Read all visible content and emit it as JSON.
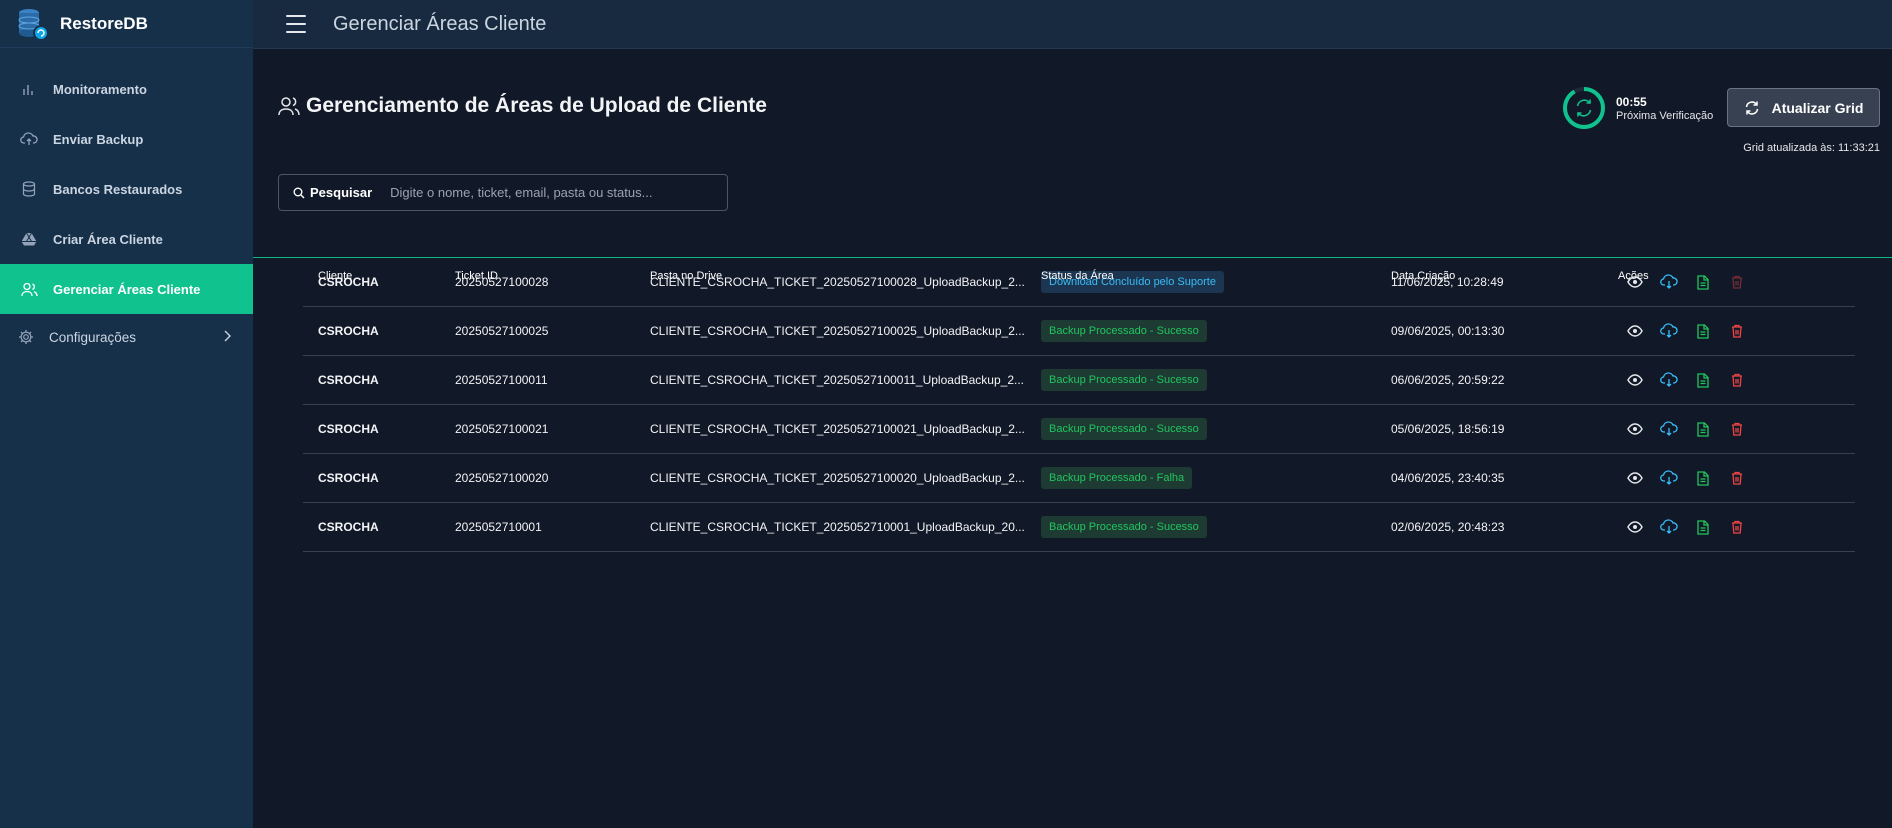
{
  "app": {
    "name": "RestoreDB"
  },
  "sidebar": {
    "items": [
      {
        "label": "Monitoramento",
        "icon": "bar-chart-icon"
      },
      {
        "label": "Enviar Backup",
        "icon": "cloud-upload-icon"
      },
      {
        "label": "Bancos Restaurados",
        "icon": "database-icon"
      },
      {
        "label": "Criar Área Cliente",
        "icon": "google-drive-icon"
      },
      {
        "label": "Gerenciar Áreas Cliente",
        "icon": "users-icon",
        "active": true
      },
      {
        "label": "Configurações",
        "icon": "gear-icon"
      }
    ]
  },
  "topbar": {
    "title": "Gerenciar Áreas Cliente"
  },
  "page": {
    "title": "Gerenciamento de Áreas de Upload de Cliente",
    "timer": {
      "value": "00:55",
      "label": "Próxima Verificação"
    },
    "refresh_button": "Atualizar Grid",
    "grid_updated": "Grid atualizada às: 11:33:21"
  },
  "search": {
    "label": "Pesquisar",
    "placeholder": "Digite o nome, ticket, email, pasta ou status...",
    "value": ""
  },
  "table": {
    "headers": {
      "client": "Cliente",
      "ticket": "Ticket ID",
      "folder": "Pasta no Drive",
      "status": "Status da Área",
      "date": "Data Criação",
      "actions": "Ações"
    },
    "rows": [
      {
        "client": "CSROCHA",
        "ticket": "20250527100028",
        "folder": "CLIENTE_CSROCHA_TICKET_20250527100028_UploadBackup_2...",
        "status": "Download Concluído pelo Suporte",
        "status_type": "info",
        "date": "11/06/2025, 10:28:49"
      },
      {
        "client": "CSROCHA",
        "ticket": "20250527100025",
        "folder": "CLIENTE_CSROCHA_TICKET_20250527100025_UploadBackup_2...",
        "status": "Backup Processado - Sucesso",
        "status_type": "ok",
        "date": "09/06/2025, 00:13:30"
      },
      {
        "client": "CSROCHA",
        "ticket": "20250527100011",
        "folder": "CLIENTE_CSROCHA_TICKET_20250527100011_UploadBackup_2...",
        "status": "Backup Processado - Sucesso",
        "status_type": "ok",
        "date": "06/06/2025, 20:59:22"
      },
      {
        "client": "CSROCHA",
        "ticket": "20250527100021",
        "folder": "CLIENTE_CSROCHA_TICKET_20250527100021_UploadBackup_2...",
        "status": "Backup Processado - Sucesso",
        "status_type": "ok",
        "date": "05/06/2025, 18:56:19"
      },
      {
        "client": "CSROCHA",
        "ticket": "20250527100020",
        "folder": "CLIENTE_CSROCHA_TICKET_20250527100020_UploadBackup_2...",
        "status": "Backup Processado - Falha",
        "status_type": "fail",
        "date": "04/06/2025, 23:40:35"
      },
      {
        "client": "CSROCHA",
        "ticket": "2025052710001",
        "folder": "CLIENTE_CSROCHA_TICKET_2025052710001_UploadBackup_20...",
        "status": "Backup Processado - Sucesso",
        "status_type": "ok",
        "date": "02/06/2025, 20:48:23"
      }
    ]
  },
  "colors": {
    "accent": "#10c28e",
    "sidebar_bg": "#16304a",
    "page_bg": "#111827",
    "success": "#22c55e",
    "info": "#38bdf8",
    "danger": "#ef4444"
  }
}
